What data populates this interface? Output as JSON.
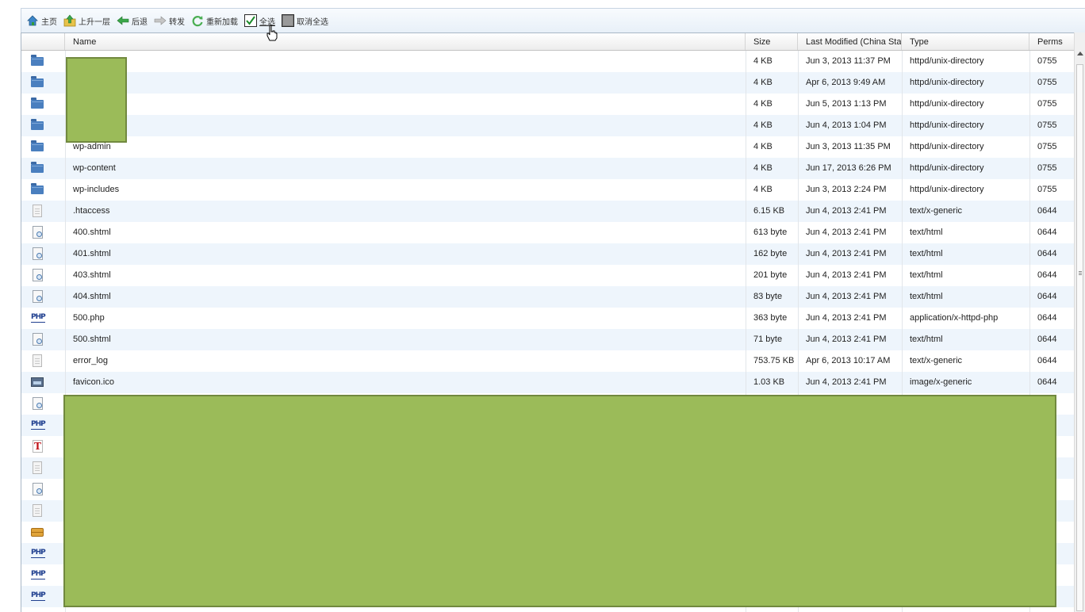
{
  "toolbar": {
    "home_label": "主页",
    "up_label": "上升一层",
    "back_label": "后退",
    "forward_label": "转发",
    "reload_label": "重新加载",
    "select_all_label": "全选",
    "deselect_all_label": "取消全选"
  },
  "columns": {
    "name": "Name",
    "size": "Size",
    "modified": "Last Modified (China Standard Time)",
    "type": "Type",
    "perms": "Perms"
  },
  "files": [
    {
      "icon": "folder-icon",
      "name": "",
      "size": "4 KB",
      "modified": "Jun 3, 2013 11:37 PM",
      "type": "httpd/unix-directory",
      "perms": "0755"
    },
    {
      "icon": "folder-icon",
      "name": "",
      "size": "4 KB",
      "modified": "Apr 6, 2013 9:49 AM",
      "type": "httpd/unix-directory",
      "perms": "0755"
    },
    {
      "icon": "folder-icon",
      "name": "",
      "size": "4 KB",
      "modified": "Jun 5, 2013 1:13 PM",
      "type": "httpd/unix-directory",
      "perms": "0755"
    },
    {
      "icon": "folder-icon",
      "name": "",
      "size": "4 KB",
      "modified": "Jun 4, 2013 1:04 PM",
      "type": "httpd/unix-directory",
      "perms": "0755"
    },
    {
      "icon": "folder-icon",
      "name": "wp-admin",
      "size": "4 KB",
      "modified": "Jun 3, 2013 11:35 PM",
      "type": "httpd/unix-directory",
      "perms": "0755"
    },
    {
      "icon": "folder-icon",
      "name": "wp-content",
      "size": "4 KB",
      "modified": "Jun 17, 2013 6:26 PM",
      "type": "httpd/unix-directory",
      "perms": "0755"
    },
    {
      "icon": "folder-icon",
      "name": "wp-includes",
      "size": "4 KB",
      "modified": "Jun 3, 2013 2:24 PM",
      "type": "httpd/unix-directory",
      "perms": "0755"
    },
    {
      "icon": "text-file-icon",
      "name": ".htaccess",
      "size": "6.15 KB",
      "modified": "Jun 4, 2013 2:41 PM",
      "type": "text/x-generic",
      "perms": "0644"
    },
    {
      "icon": "html-file-icon",
      "name": "400.shtml",
      "size": "613 byte",
      "modified": "Jun 4, 2013 2:41 PM",
      "type": "text/html",
      "perms": "0644"
    },
    {
      "icon": "html-file-icon",
      "name": "401.shtml",
      "size": "162 byte",
      "modified": "Jun 4, 2013 2:41 PM",
      "type": "text/html",
      "perms": "0644"
    },
    {
      "icon": "html-file-icon",
      "name": "403.shtml",
      "size": "201 byte",
      "modified": "Jun 4, 2013 2:41 PM",
      "type": "text/html",
      "perms": "0644"
    },
    {
      "icon": "html-file-icon",
      "name": "404.shtml",
      "size": "83 byte",
      "modified": "Jun 4, 2013 2:41 PM",
      "type": "text/html",
      "perms": "0644"
    },
    {
      "icon": "php-file-icon",
      "name": "500.php",
      "size": "363 byte",
      "modified": "Jun 4, 2013 2:41 PM",
      "type": "application/x-httpd-php",
      "perms": "0644"
    },
    {
      "icon": "html-file-icon",
      "name": "500.shtml",
      "size": "71 byte",
      "modified": "Jun 4, 2013 2:41 PM",
      "type": "text/html",
      "perms": "0644"
    },
    {
      "icon": "text-file-icon",
      "name": "error_log",
      "size": "753.75 KB",
      "modified": "Apr 6, 2013 10:17 AM",
      "type": "text/x-generic",
      "perms": "0644"
    },
    {
      "icon": "image-file-icon",
      "name": "favicon.ico",
      "size": "1.03 KB",
      "modified": "Jun 4, 2013 2:41 PM",
      "type": "image/x-generic",
      "perms": "0644"
    },
    {
      "icon": "html-file-icon",
      "name": "",
      "size": "",
      "modified": "",
      "type": "",
      "perms": ""
    },
    {
      "icon": "php-file-icon",
      "name": "",
      "size": "",
      "modified": "",
      "type": "",
      "perms": ""
    },
    {
      "icon": "font-file-icon",
      "name": "",
      "size": "",
      "modified": "",
      "type": "",
      "perms": ""
    },
    {
      "icon": "text-file-icon",
      "name": "",
      "size": "",
      "modified": "",
      "type": "",
      "perms": ""
    },
    {
      "icon": "html-file-icon",
      "name": "",
      "size": "",
      "modified": "",
      "type": "",
      "perms": ""
    },
    {
      "icon": "text-file-icon",
      "name": "",
      "size": "",
      "modified": "",
      "type": "",
      "perms": ""
    },
    {
      "icon": "archive-file-icon",
      "name": "",
      "size": "",
      "modified": "",
      "type": "",
      "perms": ""
    },
    {
      "icon": "php-file-icon",
      "name": "",
      "size": "",
      "modified": "",
      "type": "",
      "perms": ""
    },
    {
      "icon": "php-file-icon",
      "name": "",
      "size": "",
      "modified": "",
      "type": "",
      "perms": ""
    },
    {
      "icon": "php-file-icon",
      "name": "",
      "size": "",
      "modified": "",
      "type": "",
      "perms": ""
    }
  ],
  "colors": {
    "row_alt": "#eef5fc",
    "redaction": "#9bbb59",
    "folder": "#4a7fbf"
  }
}
